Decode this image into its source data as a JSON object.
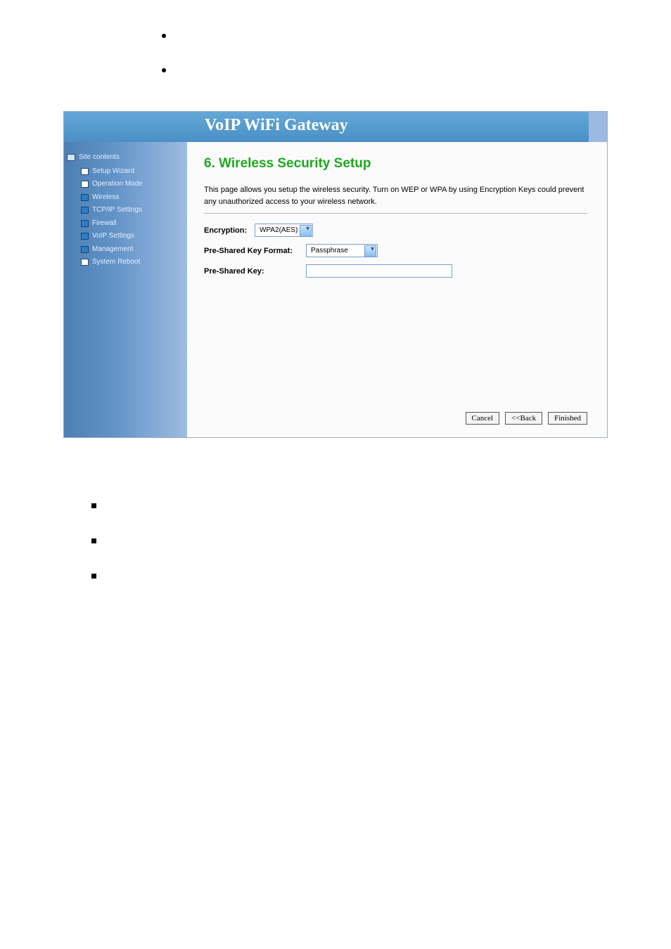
{
  "header": {
    "title": "VoIP WiFi Gateway"
  },
  "sidebar": {
    "root_label": "Site contents",
    "items": [
      {
        "label": "Setup Wizard",
        "icon": "page"
      },
      {
        "label": "Operation Mode",
        "icon": "page"
      },
      {
        "label": "Wireless",
        "icon": "folder"
      },
      {
        "label": "TCP/IP Settings",
        "icon": "folder"
      },
      {
        "label": "Firewall",
        "icon": "folder"
      },
      {
        "label": "VoIP Settings",
        "icon": "folder"
      },
      {
        "label": "Management",
        "icon": "folder"
      },
      {
        "label": "System Reboot",
        "icon": "page"
      }
    ]
  },
  "main": {
    "heading": "6. Wireless Security Setup",
    "description": "This page allows you setup the wireless security. Turn on WEP or WPA by using Encryption Keys could prevent any unauthorized access to your wireless network.",
    "form": {
      "encryption_label": "Encryption:",
      "encryption_value": "WPA2(AES)",
      "psk_format_label": "Pre-Shared Key Format:",
      "psk_format_value": "Passphrase",
      "psk_label": "Pre-Shared Key:",
      "psk_value": ""
    },
    "buttons": {
      "cancel": "Cancel",
      "back": "<<Back",
      "finished": "Finished"
    }
  }
}
